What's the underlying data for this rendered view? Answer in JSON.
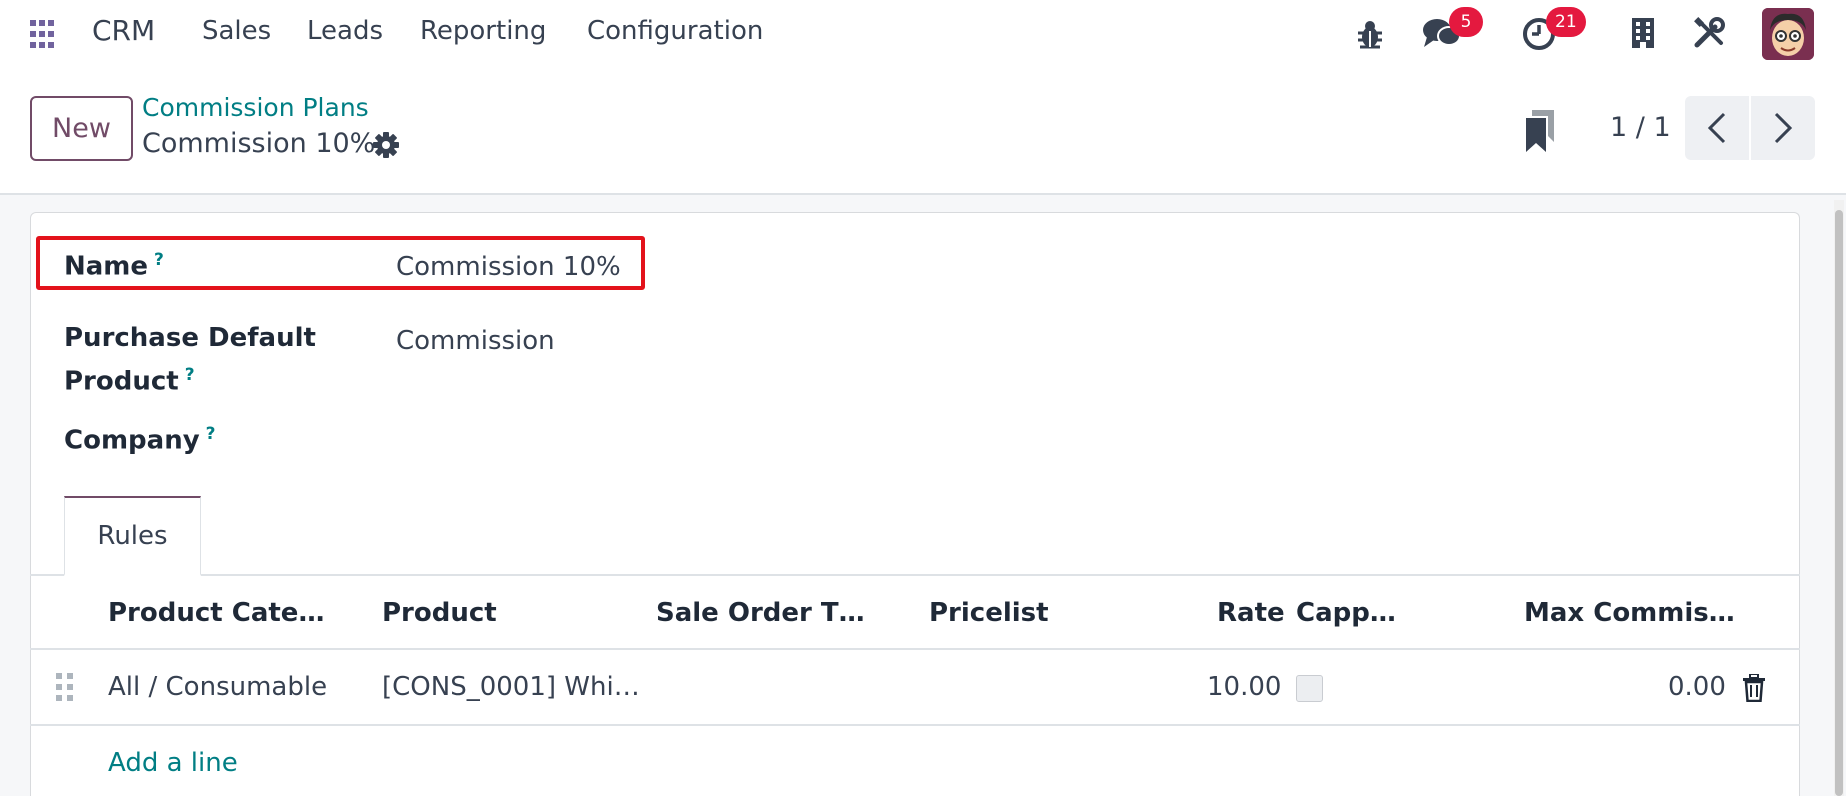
{
  "navbar": {
    "apps_icon": "grid-icon",
    "brand": "CRM",
    "menu": [
      "Sales",
      "Leads",
      "Reporting",
      "Configuration"
    ],
    "messages_badge": "5",
    "activities_badge": "21"
  },
  "control_panel": {
    "new_label": "New",
    "breadcrumb": "Commission Plans",
    "record_title": "Commission 10%",
    "pager": "1 / 1"
  },
  "form": {
    "name_label": "Name",
    "name_value": "Commission  10%",
    "purchase_label_line1": "Purchase Default",
    "purchase_label_line2": "Product",
    "purchase_value": "Commission",
    "company_label": "Company",
    "help_mark": "?"
  },
  "tabs": {
    "rules": "Rules"
  },
  "table": {
    "headers": [
      "Product Cate…",
      "Product",
      "Sale Order T…",
      "Pricelist",
      "Rate",
      "Capp…",
      "Max Commis…"
    ],
    "rows": [
      {
        "category": "All / Consumable",
        "product": "[CONS_0001] Whi…",
        "sale_order_type": "",
        "pricelist": "",
        "rate": "10.00",
        "capped": false,
        "max_commission": "0.00"
      }
    ],
    "add_line": "Add a line"
  },
  "colors": {
    "primary": "#714b67",
    "link": "#017e84",
    "badge": "#e4193f",
    "highlight": "#e3121b"
  }
}
